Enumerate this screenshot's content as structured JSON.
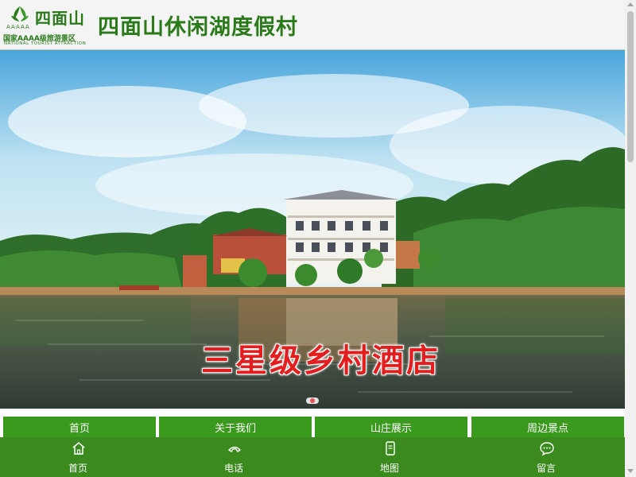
{
  "header": {
    "logo": {
      "stars": "AAAAA",
      "name": "四面山",
      "rating_text": "国家AAAA级旅游景区",
      "english_text": "NATIONAL TOURIST ATTRACTION"
    },
    "title": "四面山休闲湖度假村"
  },
  "banner": {
    "caption": "三星级乡村酒店",
    "active_slide": 1
  },
  "nav": {
    "items": [
      {
        "label": "首页"
      },
      {
        "label": "关于我们"
      },
      {
        "label": "山庄展示"
      },
      {
        "label": "周边景点"
      }
    ]
  },
  "bottom_bar": {
    "items": [
      {
        "label": "首页",
        "icon": "home-icon"
      },
      {
        "label": "电话",
        "icon": "phone-icon"
      },
      {
        "label": "地图",
        "icon": "map-icon"
      },
      {
        "label": "留言",
        "icon": "message-icon"
      }
    ]
  },
  "colors": {
    "brand_green": "#2a7a1a",
    "nav_green": "#3a9a1e",
    "bottom_bar_green": "#3a8a1e",
    "caption_red": "#e31e1e"
  }
}
